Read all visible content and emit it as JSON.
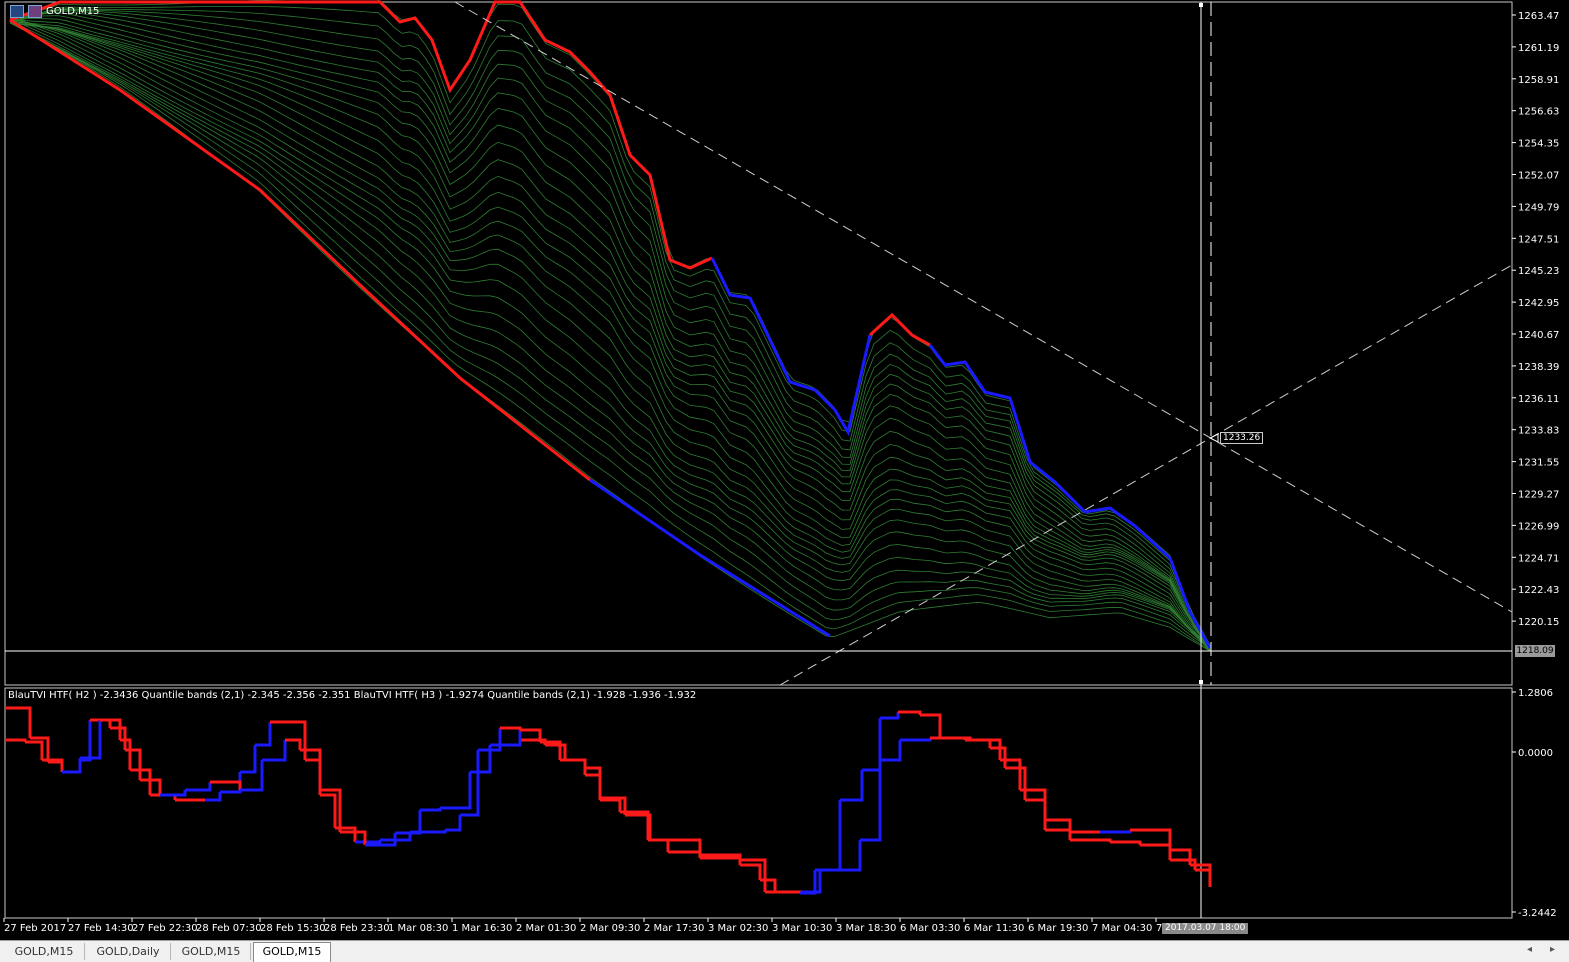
{
  "window": {
    "symbol_title": "GOLD,M15"
  },
  "price_axis": {
    "labels": [
      "1263.47",
      "1261.19",
      "1258.91",
      "1256.63",
      "1254.35",
      "1252.07",
      "1249.79",
      "1247.51",
      "1245.23",
      "1242.95",
      "1240.67",
      "1238.39",
      "1236.11",
      "1233.83",
      "1231.55",
      "1229.27",
      "1226.99",
      "1224.71",
      "1222.43",
      "1220.15"
    ],
    "current_price": "1218.09",
    "crosshair_price": "1233.26"
  },
  "indicator": {
    "title": "BlauTVI HTF( H2 ) -2.3436 Quantile bands (2,1) -2.345 -2.356 -2.351 BlauTVI HTF( H3 ) -1.9274 Quantile bands (2,1) -1.928 -1.936 -1.932",
    "scale": [
      "1.2806",
      "0.0000",
      "-3.2442"
    ],
    "colors": {
      "up": "#1a1aff",
      "down": "#ff1a1a"
    }
  },
  "time_axis": {
    "labels": [
      "27 Feb 2017",
      "27 Feb 14:30",
      "27 Feb 22:30",
      "28 Feb 07:30",
      "28 Feb 15:30",
      "28 Feb 23:30",
      "1 Mar 08:30",
      "1 Mar 16:30",
      "2 Mar 01:30",
      "2 Mar 09:30",
      "2 Mar 17:30",
      "3 Mar 02:30",
      "3 Mar 10:30",
      "3 Mar 18:30",
      "6 Mar 03:30",
      "6 Mar 11:30",
      "6 Mar 19:30",
      "7 Mar 04:30",
      "7"
    ],
    "crosshair_time": "2017.03.07 18:00"
  },
  "tabs": [
    {
      "label": "GOLD,M15"
    },
    {
      "label": "GOLD,Daily"
    },
    {
      "label": "GOLD,M15"
    },
    {
      "label": "GOLD,M15",
      "active": true
    }
  ],
  "colors": {
    "grid_line": "#ffffff",
    "mesh_red": "#b22222",
    "mesh_green": "#2e7d32",
    "mesh_blue": "#1e3fb0"
  }
}
